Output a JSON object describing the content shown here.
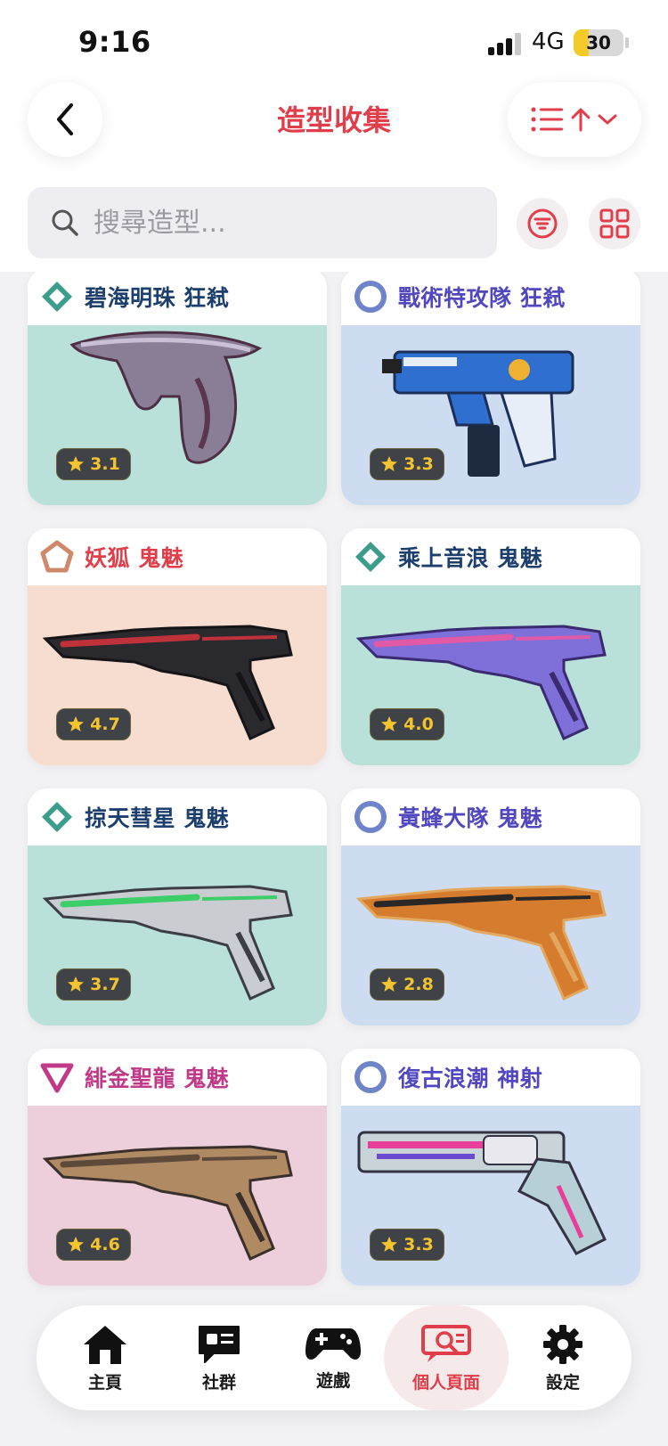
{
  "status_bar": {
    "time": "9:16",
    "network": "4G",
    "battery": "30",
    "battery_level": 0.3
  },
  "header": {
    "title": "造型收集"
  },
  "search": {
    "placeholder": "搜尋造型..."
  },
  "icons": {
    "back": "chevron-left-icon",
    "sort": "list-sort-icon",
    "filter": "filter-icon",
    "grid": "grid-view-icon",
    "search": "search-icon"
  },
  "cards": [
    {
      "name": "碧海明珠 狂弒",
      "rating": "3.1",
      "tier": "select",
      "name_color": "#1d3f6e",
      "bg": "#b9e0d9",
      "weapon": "pistol-a"
    },
    {
      "name": "戰術特攻隊 狂弒",
      "rating": "3.3",
      "tier": "deluxe",
      "name_color": "#5148c0",
      "bg": "#cddcf0",
      "weapon": "smg"
    },
    {
      "name": "妖狐 鬼魅",
      "rating": "4.7",
      "tier": "premium",
      "name_color": "#e03e4a",
      "bg": "#f7ddd0",
      "weapon": "pistol-b"
    },
    {
      "name": "乘上音浪 鬼魅",
      "rating": "4.0",
      "tier": "select",
      "name_color": "#1d3f6e",
      "bg": "#b9e0d9",
      "weapon": "pistol-c"
    },
    {
      "name": "掠天彗星 鬼魅",
      "rating": "3.7",
      "tier": "select",
      "name_color": "#1d3f6e",
      "bg": "#b9e0d9",
      "weapon": "pistol-d"
    },
    {
      "name": "黃蜂大隊 鬼魅",
      "rating": "2.8",
      "tier": "deluxe",
      "name_color": "#5148c0",
      "bg": "#cddcf0",
      "weapon": "pistol-e"
    },
    {
      "name": "緋金聖龍 鬼魅",
      "rating": "4.6",
      "tier": "exclusive",
      "name_color": "#c03a88",
      "bg": "#edcfdc",
      "weapon": "pistol-f"
    },
    {
      "name": "復古浪潮 神射",
      "rating": "3.3",
      "tier": "deluxe",
      "name_color": "#5148c0",
      "bg": "#cddcf0",
      "weapon": "revolver"
    }
  ],
  "tier_colors": {
    "select": "#3c9e8a",
    "deluxe": "#6f84c8",
    "premium": "#d0886a",
    "exclusive": "#c03a88"
  },
  "nav": [
    {
      "label": "主頁",
      "icon": "home-icon",
      "active": false
    },
    {
      "label": "社群",
      "icon": "community-icon",
      "active": false
    },
    {
      "label": "遊戲",
      "icon": "gamepad-icon",
      "active": false
    },
    {
      "label": "個人頁面",
      "icon": "profile-search-icon",
      "active": true
    },
    {
      "label": "設定",
      "icon": "gear-icon",
      "active": false
    }
  ]
}
